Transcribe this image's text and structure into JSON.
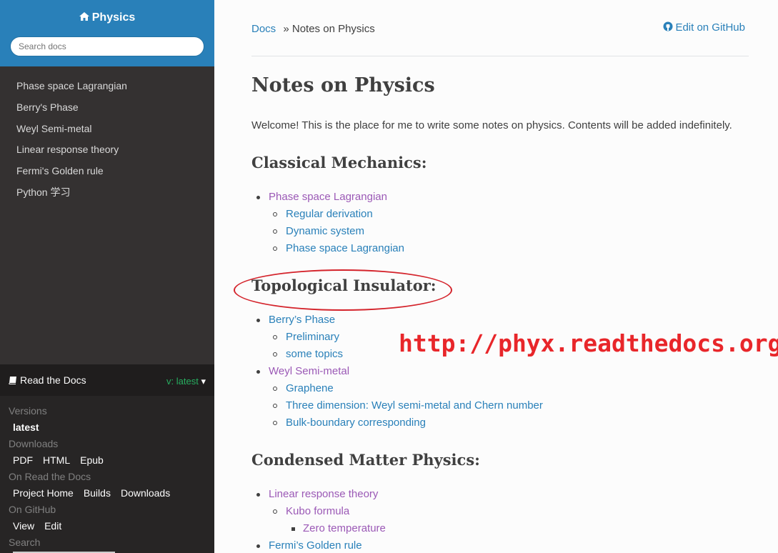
{
  "sidebar": {
    "brand": "Physics",
    "search_placeholder": "Search docs",
    "items": [
      {
        "label": "Phase space Lagrangian"
      },
      {
        "label": "Berry's Phase"
      },
      {
        "label": "Weyl Semi-metal"
      },
      {
        "label": "Linear response theory"
      },
      {
        "label": "Fermi's Golden rule"
      },
      {
        "label": "Python 学习"
      }
    ]
  },
  "rtd_panel": {
    "title": "Read the Docs",
    "version": "v: latest",
    "versions_heading": "Versions",
    "versions": [
      "latest"
    ],
    "downloads_heading": "Downloads",
    "downloads": [
      "PDF",
      "HTML",
      "Epub"
    ],
    "on_rtd_heading": "On Read the Docs",
    "on_rtd": [
      "Project Home",
      "Builds",
      "Downloads"
    ],
    "on_github_heading": "On GitHub",
    "on_github": [
      "View",
      "Edit"
    ],
    "search_heading": "Search"
  },
  "breadcrumb": {
    "root": "Docs",
    "sep": "»",
    "current": "Notes on Physics"
  },
  "edit_link": "Edit on GitHub",
  "page_title": "Notes on Physics",
  "intro": "Welcome! This is the place for me to write some notes on physics. Contents will be added indefinitely.",
  "sections": {
    "classical": {
      "heading": "Classical Mechanics:",
      "items": [
        "Phase space Lagrangian",
        "Regular derivation",
        "Dynamic system",
        "Phase space Lagrangian"
      ]
    },
    "topological": {
      "heading": "Topological Insulator:",
      "items": [
        "Berry’s Phase",
        "Preliminary",
        "some topics",
        "Weyl Semi-metal",
        "Graphene",
        "Three dimension: Weyl semi-metal and Chern number",
        "Bulk-boundary corresponding"
      ]
    },
    "condensed": {
      "heading": "Condensed Matter Physics:",
      "items": [
        "Linear response theory",
        "Kubo formula",
        "Zero temperature",
        "Fermi’s Golden rule"
      ]
    }
  },
  "annotation_url": "http://phyx.readthedocs.org/",
  "colors": {
    "accent": "#2980b9",
    "visited": "#9b59b6",
    "annotation": "#e8262a"
  }
}
